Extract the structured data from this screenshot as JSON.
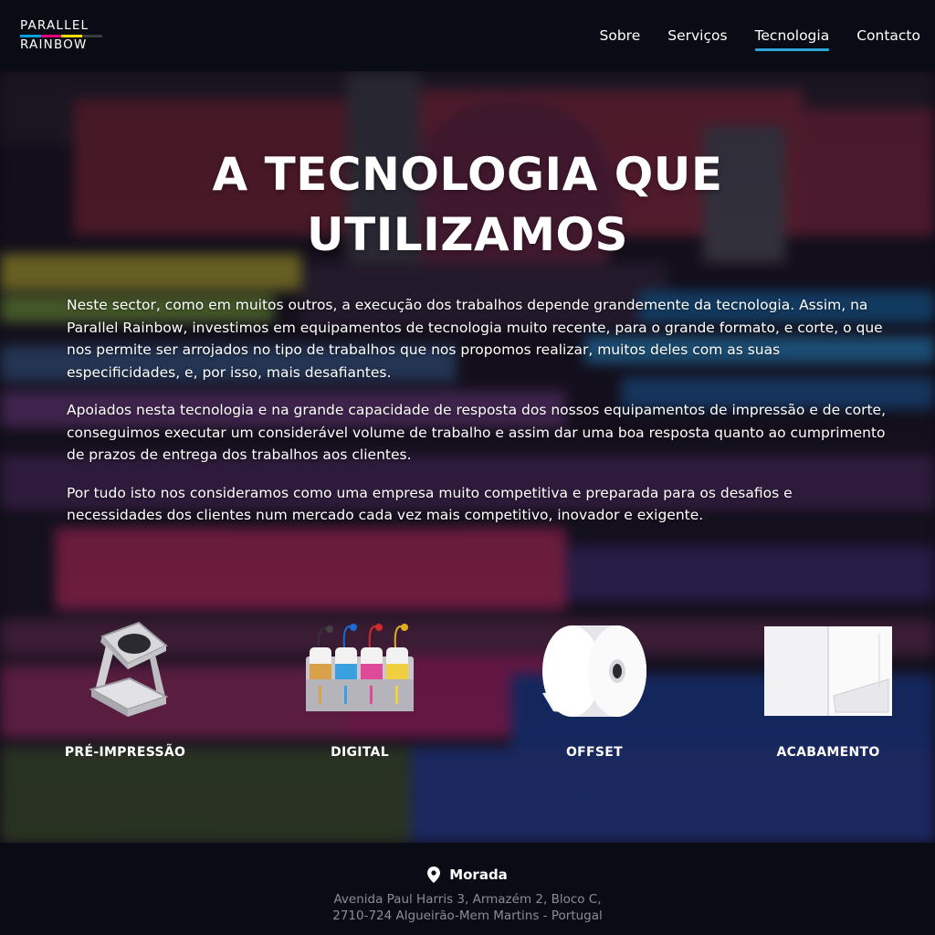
{
  "header": {
    "logo": {
      "line1": "PARALLEL",
      "line2": "RAINBOW",
      "stripe_colors": [
        "#00a0e0",
        "#e6007e",
        "#ffde00",
        "#1a1a1a"
      ]
    },
    "nav": [
      {
        "label": "Sobre",
        "active": false
      },
      {
        "label": "Serviços",
        "active": false
      },
      {
        "label": "Tecnologia",
        "active": true
      },
      {
        "label": "Contacto",
        "active": false
      }
    ],
    "active_underline_color": "#2aa8d8"
  },
  "hero": {
    "title_line1": "A TECNOLOGIA QUE",
    "title_line2": "UTILIZAMOS",
    "paragraphs": [
      "Neste sector, como em muitos outros, a execução dos trabalhos depende grandemente da tecnologia. Assim, na Parallel Rainbow, investimos em equipamentos de tecnologia muito recente, para o grande formato, e corte, o que nos permite ser arrojados no tipo de trabalhos que nos propomos realizar, muitos deles com as suas especificidades, e, por isso, mais desafiantes.",
      "Apoiados nesta tecnologia e na grande capacidade de resposta dos nossos equipamentos de impressão e de corte, conseguimos executar um considerável volume de trabalho e assim dar uma boa resposta quanto ao cumprimento de prazos de entrega dos trabalhos aos clientes.",
      "Por tudo isto nos consideramos como uma empresa muito competitiva e preparada para os desafios e necessidades dos clientes num mercado cada vez mais competitivo, inovador e exigente."
    ]
  },
  "services": [
    {
      "label": "PRÉ-IMPRESSÃO",
      "icon": "magnifier-loupe-icon"
    },
    {
      "label": "DIGITAL",
      "icon": "ink-bottles-icon"
    },
    {
      "label": "OFFSET",
      "icon": "paper-roll-icon"
    },
    {
      "label": "ACABAMENTO",
      "icon": "folder-icon"
    }
  ],
  "footer": {
    "icon": "location-pin-icon",
    "title": "Morada",
    "address_line1": "Avenida Paul Harris 3, Armazém 2, Bloco C,",
    "address_line2": "2710-724 Algueirão-Mem Martins - Portugal"
  }
}
